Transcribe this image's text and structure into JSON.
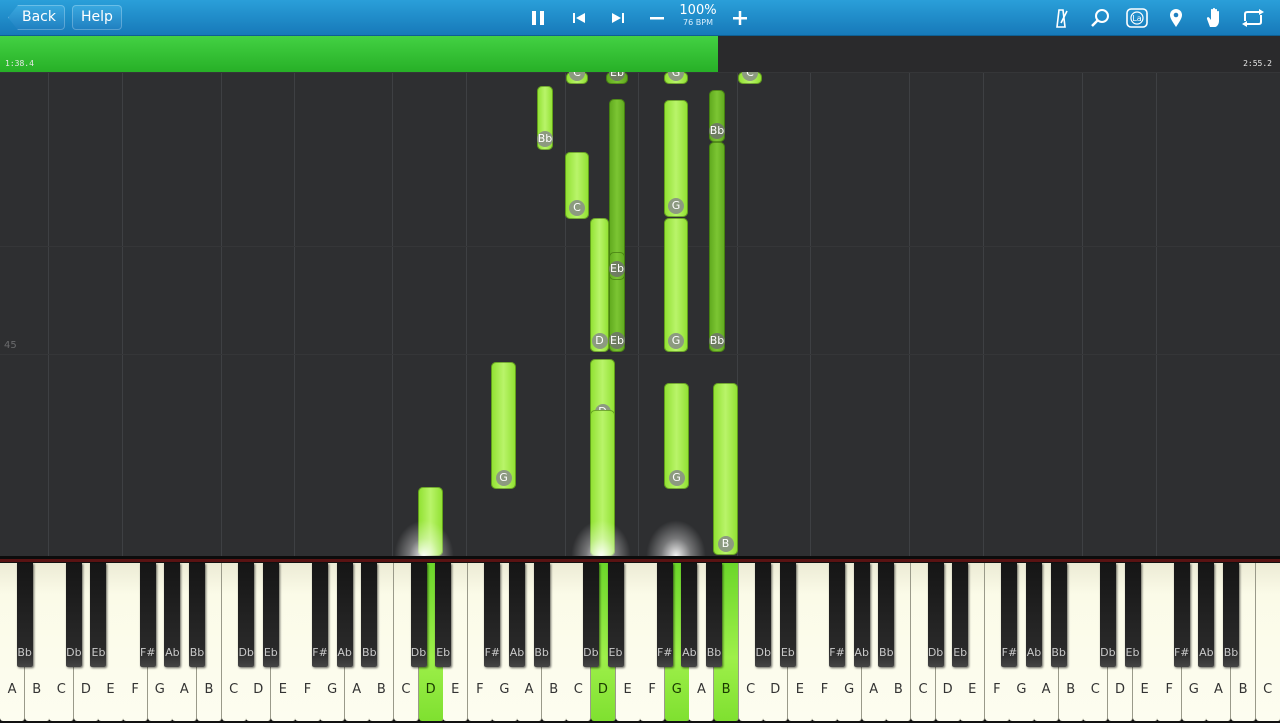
{
  "toolbar": {
    "back_label": "Back",
    "help_label": "Help",
    "speed_percent": "100%",
    "bpm": "76 BPM",
    "icons": [
      "pause-icon",
      "previous-icon",
      "next-icon",
      "minus-icon",
      "plus-icon",
      "metronome-icon",
      "search-icon",
      "label-icon",
      "marker-icon",
      "hand-icon",
      "loop-icon"
    ],
    "label_icon_text": "La"
  },
  "progress": {
    "elapsed": "1:38.4",
    "total": "2:55.2",
    "fraction": 0.561,
    "fill_color": "#34c234"
  },
  "roll": {
    "measure_number": "45",
    "note_color": "#a6ea4e",
    "note_dark_color": "#6bb62a"
  },
  "notes": [
    {
      "name": "C",
      "label": "C",
      "color": "light"
    },
    {
      "name": "Eb",
      "label": "Eb",
      "color": "dark"
    },
    {
      "name": "G",
      "label": "G",
      "color": "light"
    },
    {
      "name": "C",
      "label": "C",
      "color": "light"
    },
    {
      "name": "Bb",
      "label": "Bb",
      "color": "light"
    },
    {
      "name": "C",
      "label": "C",
      "color": "light"
    },
    {
      "name": "Eb",
      "label": "Eb",
      "color": "dark"
    },
    {
      "name": "G",
      "label": "G",
      "color": "light"
    },
    {
      "name": "Bb",
      "label": "Bb",
      "color": "dark"
    },
    {
      "name": "Eb",
      "label": "Eb",
      "color": "dark"
    },
    {
      "name": "D",
      "label": "D",
      "color": "light"
    },
    {
      "name": "Eb",
      "label": "Eb",
      "color": "dark"
    },
    {
      "name": "G",
      "label": "G",
      "color": "light"
    },
    {
      "name": "Bb",
      "label": "Bb",
      "color": "dark"
    },
    {
      "name": "G",
      "label": "G",
      "color": "light"
    },
    {
      "name": "D",
      "label": "D",
      "color": "light"
    },
    {
      "name": "G",
      "label": "G",
      "color": "light"
    },
    {
      "name": "D",
      "label": "",
      "color": "light"
    },
    {
      "name": "B",
      "label": "B",
      "color": "light"
    }
  ],
  "piano": {
    "white_keys": [
      "A",
      "B",
      "C",
      "D",
      "E",
      "F",
      "G",
      "A",
      "B",
      "C",
      "D",
      "E",
      "F",
      "G",
      "A",
      "B",
      "C",
      "D",
      "E",
      "F",
      "G",
      "A",
      "B",
      "C",
      "D",
      "E",
      "F",
      "G",
      "A",
      "B",
      "C",
      "D",
      "E",
      "F",
      "G",
      "A",
      "B",
      "C",
      "D",
      "E",
      "F",
      "G",
      "A",
      "B",
      "C",
      "D",
      "E",
      "F",
      "G",
      "A",
      "B",
      "C"
    ],
    "black_keys": [
      "Bb",
      "Db",
      "Eb",
      "F#",
      "Ab",
      "Bb",
      "Db",
      "Eb",
      "F#",
      "Ab",
      "Bb",
      "Db",
      "Eb",
      "F#",
      "Ab",
      "Bb",
      "Db",
      "Eb",
      "F#",
      "Ab",
      "Bb",
      "Db",
      "Eb",
      "F#",
      "Ab",
      "Bb",
      "Db",
      "Eb",
      "F#",
      "Ab",
      "Bb",
      "Db",
      "Eb",
      "F#",
      "Ab",
      "Bb"
    ],
    "pressed_white": [
      17,
      24,
      27,
      29
    ],
    "pressed_black": [],
    "pressed_color": "#8ee83a"
  }
}
